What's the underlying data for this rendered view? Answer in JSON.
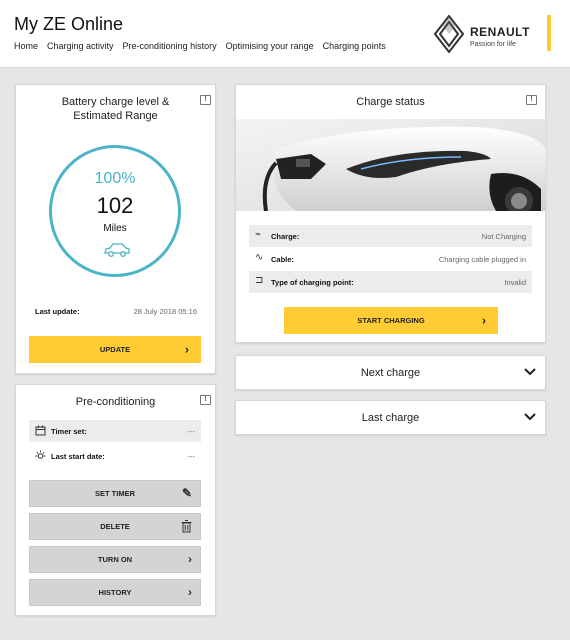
{
  "header": {
    "title": "My ZE Online",
    "nav": [
      "Home",
      "Charging activity",
      "Pre-conditioning history",
      "Optimising your range",
      "Charging points"
    ],
    "brand": {
      "name": "RENAULT",
      "tagline": "Passion for life",
      "accent_color": "#ffcc33"
    }
  },
  "battery": {
    "title_line1": "Battery charge level &",
    "title_line2": "Estimated Range",
    "percent": "100%",
    "range_value": "102",
    "range_unit": "Miles",
    "last_update_label": "Last update:",
    "last_update_value": "28 July 2018 05:16",
    "update_button": "UPDATE",
    "ring_color": "#4bb4c8"
  },
  "preconditioning": {
    "title": "Pre-conditioning",
    "rows": [
      {
        "label": "Timer set:",
        "value": "---",
        "icon": "calendar-icon"
      },
      {
        "label": "Last start date:",
        "value": "---",
        "icon": "sun-icon"
      }
    ],
    "buttons": [
      {
        "label": "SET TIMER",
        "icon": "pencil-icon"
      },
      {
        "label": "DELETE",
        "icon": "trash-icon"
      },
      {
        "label": "TURN ON",
        "icon": "chevron-right-icon"
      },
      {
        "label": "HISTORY",
        "icon": "chevron-right-icon"
      }
    ]
  },
  "charge_status": {
    "title": "Charge status",
    "rows": [
      {
        "label": "Charge:",
        "value": "Not Charging",
        "icon": "plug-icon"
      },
      {
        "label": "Cable:",
        "value": "Charging cable plugged in",
        "icon": "cable-icon"
      },
      {
        "label": "Type of charging point:",
        "value": "Invalid",
        "icon": "charging-point-icon"
      }
    ],
    "start_button": "START CHARGING"
  },
  "accordions": [
    {
      "title": "Next charge"
    },
    {
      "title": "Last charge"
    }
  ]
}
